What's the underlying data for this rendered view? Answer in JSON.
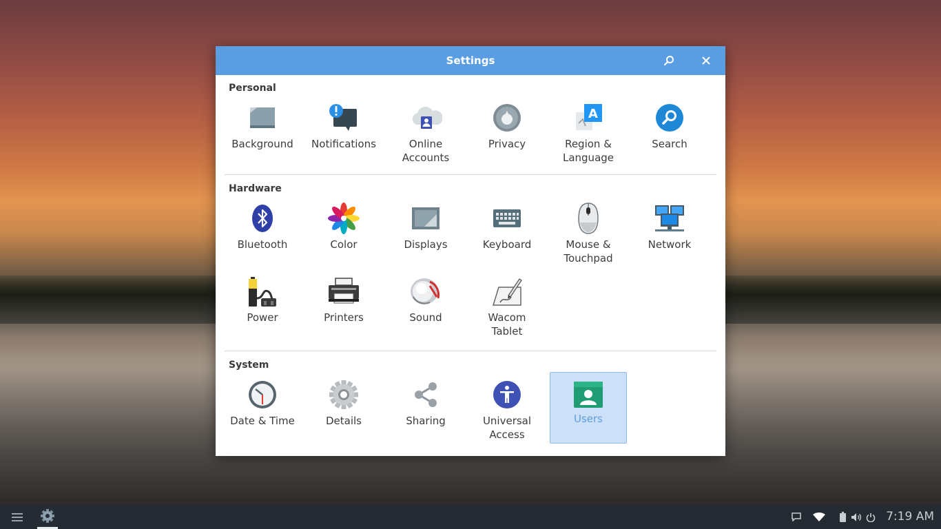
{
  "window": {
    "title": "Settings"
  },
  "sections": {
    "personal": {
      "title": "Personal",
      "items": [
        {
          "label": "Background"
        },
        {
          "label": "Notifications"
        },
        {
          "label": "Online\nAccounts"
        },
        {
          "label": "Privacy"
        },
        {
          "label": "Region &\nLanguage"
        },
        {
          "label": "Search"
        }
      ]
    },
    "hardware": {
      "title": "Hardware",
      "items": [
        {
          "label": "Bluetooth"
        },
        {
          "label": "Color"
        },
        {
          "label": "Displays"
        },
        {
          "label": "Keyboard"
        },
        {
          "label": "Mouse &\nTouchpad"
        },
        {
          "label": "Network"
        },
        {
          "label": "Power"
        },
        {
          "label": "Printers"
        },
        {
          "label": "Sound"
        },
        {
          "label": "Wacom\nTablet"
        }
      ]
    },
    "system": {
      "title": "System",
      "items": [
        {
          "label": "Date & Time"
        },
        {
          "label": "Details"
        },
        {
          "label": "Sharing"
        },
        {
          "label": "Universal\nAccess"
        },
        {
          "label": "Users",
          "selected": true
        }
      ]
    }
  },
  "taskbar": {
    "clock": "7:19 AM"
  },
  "colors": {
    "titlebar": "#5a9de3",
    "selection": "#cce0f8",
    "taskbar": "#242b33"
  }
}
